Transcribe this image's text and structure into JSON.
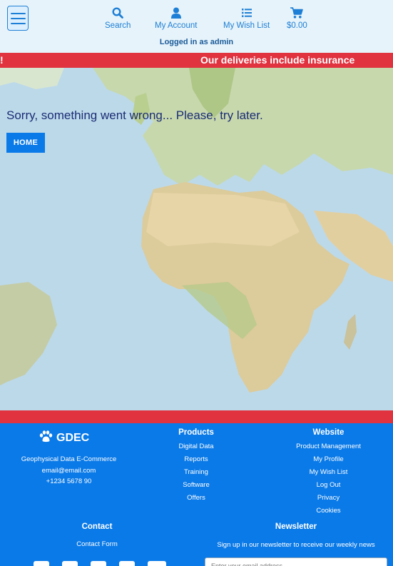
{
  "header": {
    "nav": [
      {
        "label": "Search",
        "icon": "search-icon"
      },
      {
        "label": "My Account",
        "icon": "user-icon"
      },
      {
        "label": "My Wish List",
        "icon": "list-icon"
      },
      {
        "label": "$0.00",
        "icon": "cart-icon"
      }
    ],
    "logged_in": "Logged in as admin"
  },
  "marquee": {
    "tail": "!",
    "message": "Our deliveries include insurance"
  },
  "main": {
    "error": "Sorry, something went wrong... Please, try later.",
    "home_label": "HOME"
  },
  "footer": {
    "brand": "GDEC",
    "company": "Geophysical Data E-Commerce",
    "email": "email@email.com",
    "phone": "+1234 5678 90",
    "products": {
      "title": "Products",
      "items": [
        "Digital Data",
        "Reports",
        "Training",
        "Software",
        "Offers"
      ]
    },
    "website": {
      "title": "Website",
      "items": [
        "Product Management",
        "My Profile",
        "My Wish List",
        "Log Out",
        "Privacy",
        "Cookies"
      ]
    },
    "contact": {
      "title": "Contact",
      "form_label": "Contact Form"
    },
    "newsletter": {
      "title": "Newsletter",
      "text": "Sign up in our newsletter to receive our weekly news",
      "placeholder": "Enter your email address"
    }
  },
  "colors": {
    "accent": "#0a7ae8",
    "banner": "#e0323f",
    "header_bg": "#e6f3fa"
  }
}
